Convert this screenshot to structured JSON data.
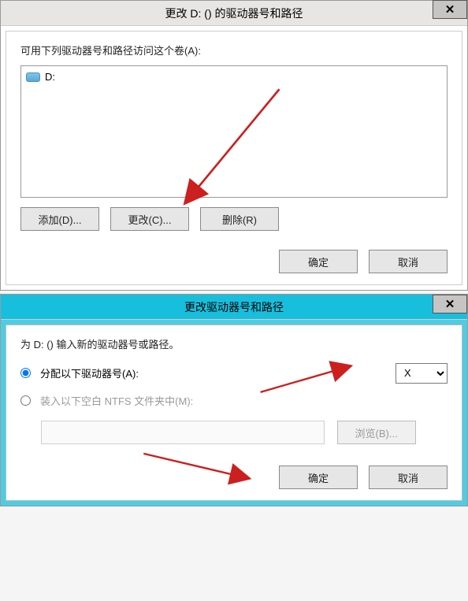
{
  "dialog1": {
    "title": "更改 D: () 的驱动器号和路径",
    "close": "✕",
    "prompt": "可用下列驱动器号和路径访问这个卷(A):",
    "list_item": "D:",
    "buttons": {
      "add": "添加(D)...",
      "change": "更改(C)...",
      "remove": "删除(R)"
    },
    "ok": "确定",
    "cancel": "取消"
  },
  "dialog2": {
    "title": "更改驱动器号和路径",
    "close": "✕",
    "prompt": "为 D: () 输入新的驱动器号或路径。",
    "radio_assign": "分配以下驱动器号(A):",
    "radio_mount": "装入以下空白 NTFS 文件夹中(M):",
    "drive_options": [
      "X"
    ],
    "selected_drive": "X",
    "browse": "浏览(B)...",
    "ok": "确定",
    "cancel": "取消"
  }
}
